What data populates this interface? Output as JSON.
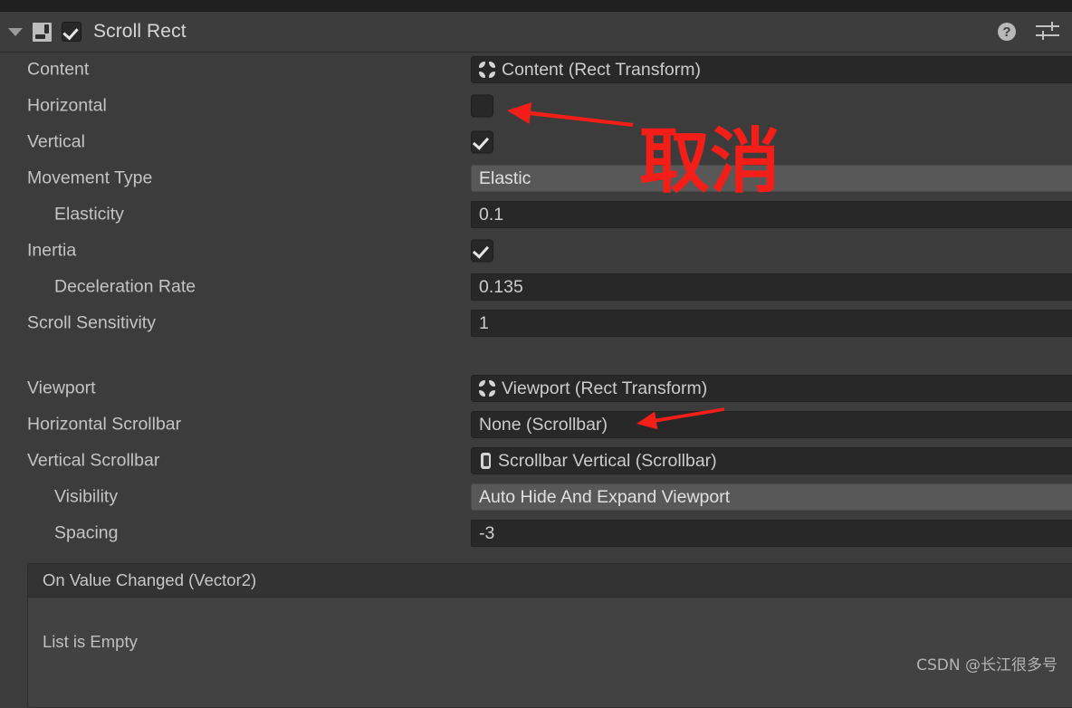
{
  "top_strip": {
    "present": true
  },
  "header": {
    "foldout_expanded": true,
    "component_icon": "scroll-rect-icon",
    "enabled": true,
    "title": "Scroll Rect",
    "help_label": "?",
    "help_icon": "help-icon",
    "preset_icon": "preset-settings-icon"
  },
  "properties": [
    {
      "label": "Content",
      "indent": false,
      "type": "object",
      "value": "Content (Rect Transform)",
      "icon": "rect-transform-icon"
    },
    {
      "label": "Horizontal",
      "indent": false,
      "type": "checkbox",
      "checked": false
    },
    {
      "label": "Vertical",
      "indent": false,
      "type": "checkbox",
      "checked": true
    },
    {
      "label": "Movement Type",
      "indent": false,
      "type": "popup",
      "value": "Elastic"
    },
    {
      "label": "Elasticity",
      "indent": true,
      "type": "text",
      "value": "0.1"
    },
    {
      "label": "Inertia",
      "indent": false,
      "type": "checkbox",
      "checked": true
    },
    {
      "label": "Deceleration Rate",
      "indent": true,
      "type": "text",
      "value": "0.135"
    },
    {
      "label": "Scroll Sensitivity",
      "indent": false,
      "type": "text",
      "value": "1"
    },
    {
      "label": "",
      "indent": false,
      "type": "gap"
    },
    {
      "label": "Viewport",
      "indent": false,
      "type": "object",
      "value": "Viewport (Rect Transform)",
      "icon": "rect-transform-icon"
    },
    {
      "label": "Horizontal Scrollbar",
      "indent": false,
      "type": "object",
      "value": "None (Scrollbar)",
      "icon": "none"
    },
    {
      "label": "Vertical Scrollbar",
      "indent": false,
      "type": "object",
      "value": "Scrollbar Vertical (Scrollbar)",
      "icon": "scrollbar-icon"
    },
    {
      "label": "Visibility",
      "indent": true,
      "type": "popup",
      "value": "Auto Hide And Expand Viewport"
    },
    {
      "label": "Spacing",
      "indent": true,
      "type": "text",
      "value": "-3"
    }
  ],
  "unity_event": {
    "title": "On Value Changed (Vector2)",
    "empty_text": "List is Empty"
  },
  "annotations": {
    "color": "#f41e18",
    "text_1": "取消",
    "arrow_1": "arrow-pointing-to-horizontal-checkbox",
    "arrow_2": "arrow-pointing-to-horizontal-scrollbar-field"
  },
  "watermark": {
    "text": "CSDN @长江很多号"
  }
}
